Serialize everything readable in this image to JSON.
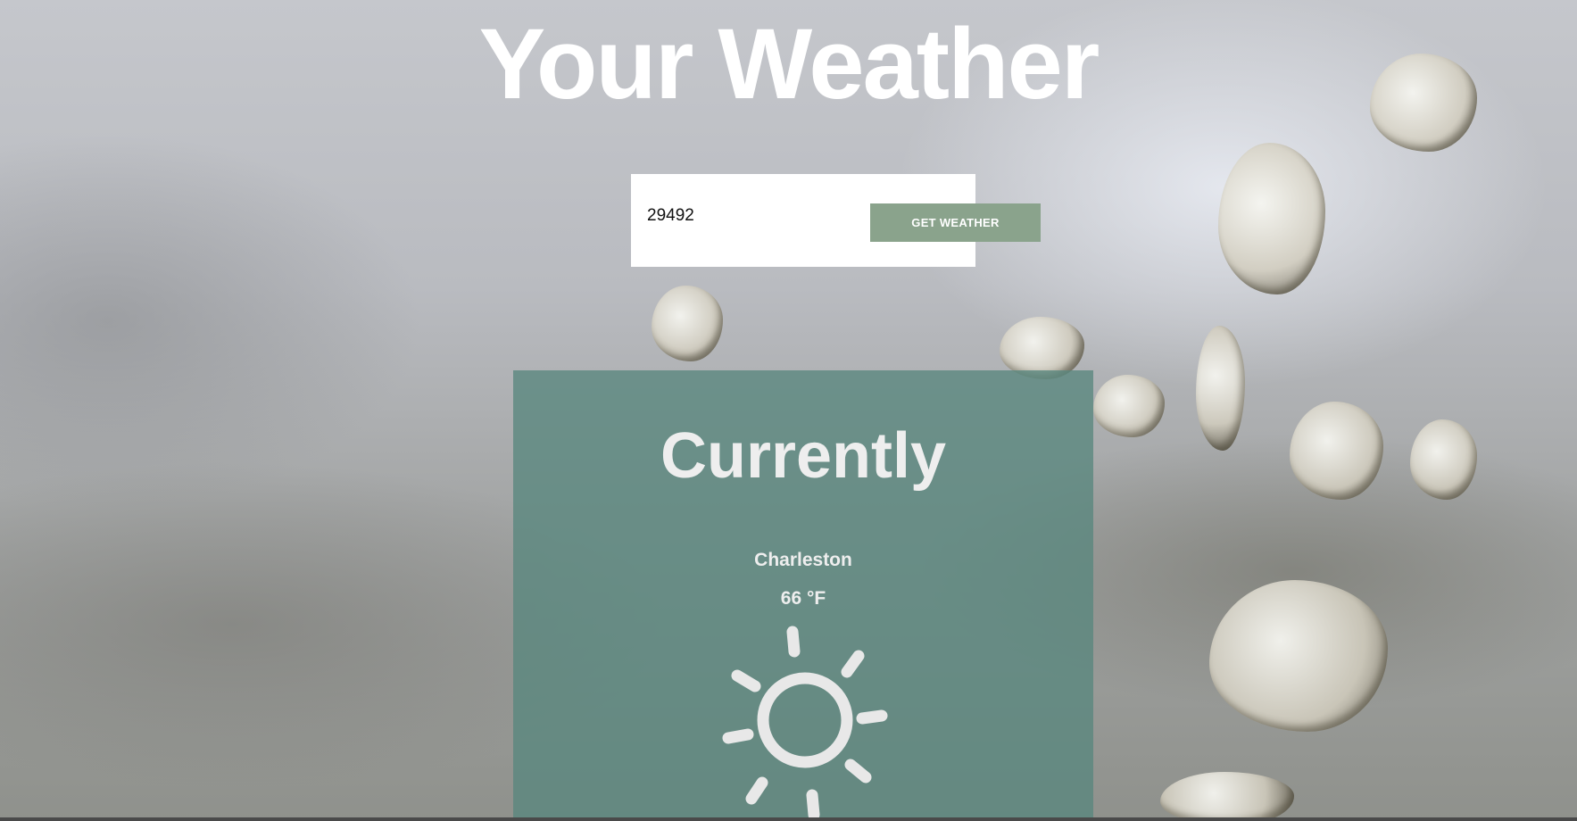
{
  "header": {
    "title": "Your Weather"
  },
  "search": {
    "zip_value": "29492",
    "button_label": "GET WEATHER"
  },
  "current": {
    "heading": "Currently",
    "city": "Charleston",
    "temperature": "66 °F",
    "icon": "sun-icon"
  },
  "colors": {
    "button": "#8aa38c",
    "card": "#58877d",
    "title_text": "#ffffff"
  }
}
